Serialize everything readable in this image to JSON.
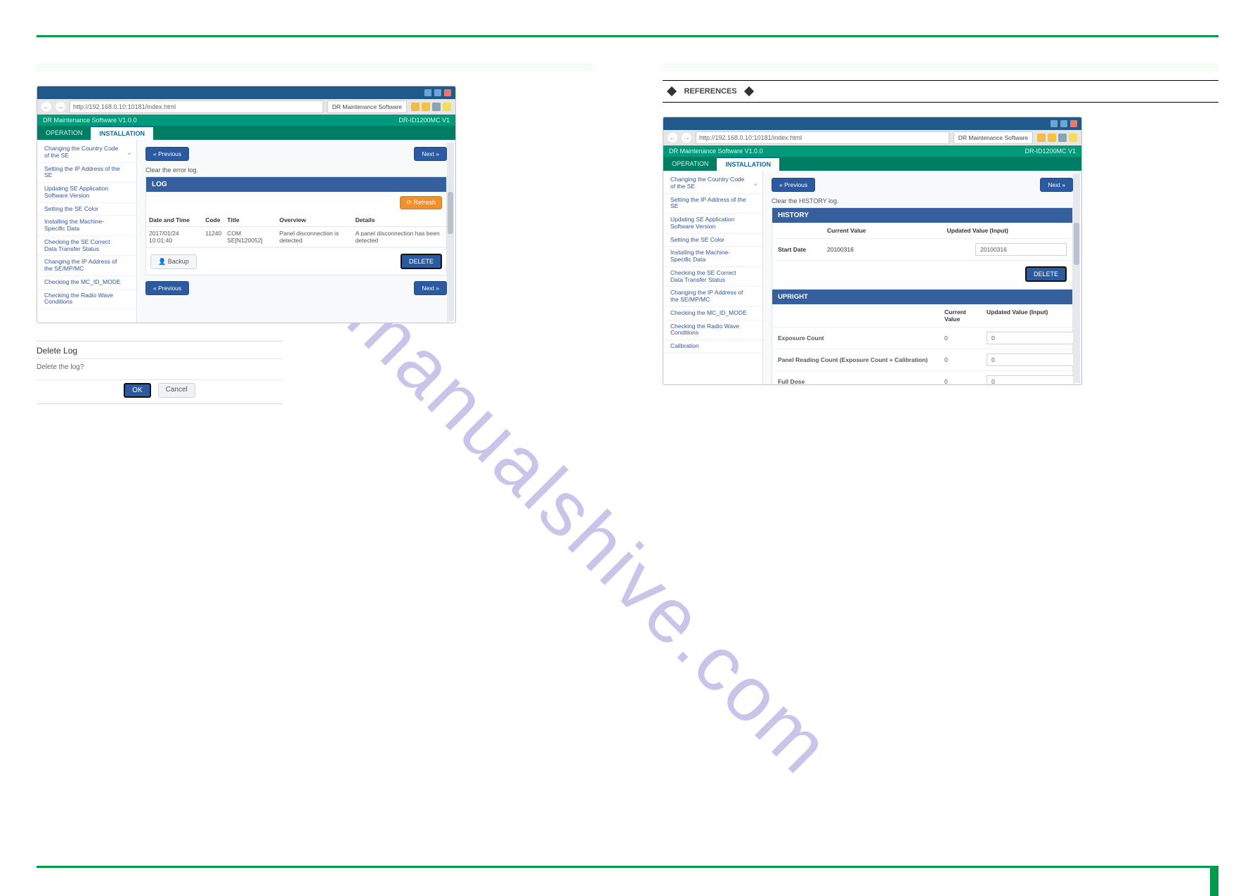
{
  "watermark": "manualshive.com",
  "shared": {
    "app": {
      "url": "http://192.168.0.10:10181/index.html",
      "browserTab": "DR Maintenance Software",
      "name": "DR Maintenance Software V1.0.0",
      "model": "DR-ID1200MC V1",
      "tabs": {
        "op": "OPERATION",
        "inst": "INSTALLATION"
      }
    },
    "sidebar": {
      "items": [
        "Changing the Country Code of the SE",
        "Setting the IP Address of the SE",
        "Updating SE Application Software Version",
        "Setting the SE Color",
        "Installing the Machine-Specific Data",
        "Checking the SE Correct Data Transfer Status",
        "Changing the IP Address of the SE/MP/MC",
        "Checking the MC_ID_MODE",
        "Checking the Radio Wave Conditions",
        "Calibration"
      ]
    },
    "btn": {
      "prev": "« Previous",
      "next": "Next »",
      "refresh": "⟳ Refresh",
      "backup": "Backup",
      "delete": "DELETE",
      "ok": "OK",
      "cancel": "Cancel"
    }
  },
  "left": {
    "heading": " ",
    "steps": {
      "s3": " ",
      "s4": " "
    },
    "shot": {
      "instruction": "Clear the error log.",
      "panelTitle": "LOG",
      "cols": {
        "dt": "Date and Time",
        "code": "Code",
        "title": "Title",
        "ov": "Overview",
        "det": "Details"
      },
      "row": {
        "dt": "2017/01/24 10:01:40",
        "code": "11240",
        "title": "COM SE[N120052]",
        "ov": "Panel disconnection is detected",
        "det": "A panel disconnection has been detected"
      }
    },
    "dialog": {
      "title": "Delete Log",
      "body": "Delete the log?"
    }
  },
  "right": {
    "heading": " ",
    "ref": {
      "label": "REFERENCES",
      "target": ""
    },
    "steps": {
      "note": " ",
      "s1": " "
    },
    "shot": {
      "instruction": "Clear the HISTORY log.",
      "panelTitle": "HISTORY",
      "headers": {
        "cur": "Current Value",
        "inp": "Updated Value (Input)"
      },
      "startDate": {
        "label": "Start Date",
        "current": "20100316",
        "input": "20100316"
      },
      "sub": "UPRIGHT",
      "rows": [
        {
          "label": "Exposure Count",
          "cur": "0",
          "inp": "0"
        },
        {
          "label": "Panel Reading Count (Exposure Count + Calibration)",
          "cur": "0",
          "inp": "0"
        },
        {
          "label": "Full Dose",
          "cur": "0",
          "inp": "0"
        }
      ]
    }
  }
}
